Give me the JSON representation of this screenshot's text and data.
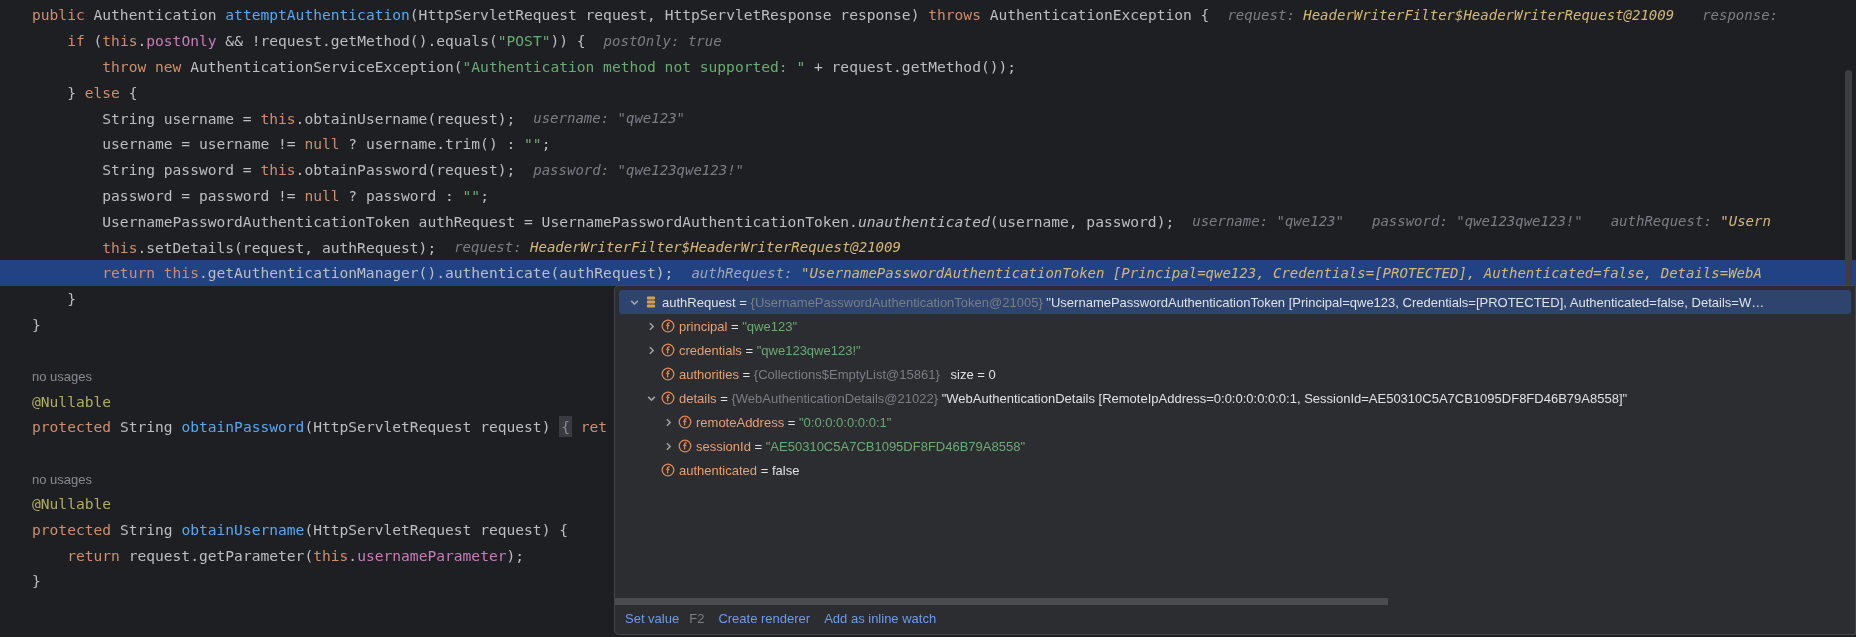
{
  "editor": {
    "lines": [
      {
        "tokens": [
          {
            "kind": "kw",
            "text": "public "
          },
          {
            "kind": "plain",
            "text": "Authentication "
          },
          {
            "kind": "fn",
            "text": "attemptAuthentication"
          },
          {
            "kind": "plain",
            "text": "(HttpServletRequest request, HttpServletResponse response) "
          },
          {
            "kind": "kw",
            "text": "throws "
          },
          {
            "kind": "plain",
            "text": "AuthenticationException {"
          }
        ],
        "hints": [
          {
            "label": "request:",
            "value": "HeaderWriterFilter$HeaderWriterRequest@21009",
            "kind": "object"
          },
          {
            "label": "response:"
          }
        ],
        "highlighted": false
      },
      {
        "tokens": [
          {
            "kind": "kw",
            "text": "    if "
          },
          {
            "kind": "plain",
            "text": "("
          },
          {
            "kind": "kw",
            "text": "this"
          },
          {
            "kind": "plain",
            "text": "."
          },
          {
            "kind": "field",
            "text": "postOnly"
          },
          {
            "kind": "plain",
            "text": " && !request.getMethod().equals("
          },
          {
            "kind": "str",
            "text": "\"POST\""
          },
          {
            "kind": "plain",
            "text": ")) {"
          }
        ],
        "hints": [
          {
            "label": "postOnly:",
            "value": "true",
            "kind": "plain"
          }
        ],
        "highlighted": false
      },
      {
        "tokens": [
          {
            "kind": "kw",
            "text": "        throw new "
          },
          {
            "kind": "plain",
            "text": "AuthenticationServiceException("
          },
          {
            "kind": "str",
            "text": "\"Authentication method not supported: \""
          },
          {
            "kind": "plain",
            "text": " + request.getMethod());"
          }
        ],
        "highlighted": false
      },
      {
        "tokens": [
          {
            "kind": "plain",
            "text": "    } "
          },
          {
            "kind": "kw",
            "text": "else"
          },
          {
            "kind": "plain",
            "text": " {"
          }
        ],
        "highlighted": false
      },
      {
        "tokens": [
          {
            "kind": "plain",
            "text": "        String username = "
          },
          {
            "kind": "kw",
            "text": "this"
          },
          {
            "kind": "plain",
            "text": ".obtainUsername(request);"
          }
        ],
        "hints": [
          {
            "label": "username:",
            "value": "\"qwe123\"",
            "kind": "plain"
          }
        ],
        "highlighted": false
      },
      {
        "tokens": [
          {
            "kind": "plain",
            "text": "        username = username != "
          },
          {
            "kind": "kw",
            "text": "null"
          },
          {
            "kind": "plain",
            "text": " ? username.trim() : "
          },
          {
            "kind": "str",
            "text": "\"\""
          },
          {
            "kind": "plain",
            "text": ";"
          }
        ],
        "highlighted": false
      },
      {
        "tokens": [
          {
            "kind": "plain",
            "text": "        String password = "
          },
          {
            "kind": "kw",
            "text": "this"
          },
          {
            "kind": "plain",
            "text": ".obtainPassword(request);"
          }
        ],
        "hints": [
          {
            "label": "password:",
            "value": "\"qwe123qwe123!\"",
            "kind": "plain"
          }
        ],
        "highlighted": false
      },
      {
        "tokens": [
          {
            "kind": "plain",
            "text": "        password = password != "
          },
          {
            "kind": "kw",
            "text": "null"
          },
          {
            "kind": "plain",
            "text": " ? password : "
          },
          {
            "kind": "str",
            "text": "\"\""
          },
          {
            "kind": "plain",
            "text": ";"
          }
        ],
        "highlighted": false
      },
      {
        "tokens": [
          {
            "kind": "plain",
            "text": "        UsernamePasswordAuthenticationToken authRequest = UsernamePasswordAuthenticationToken."
          },
          {
            "kind": "italic",
            "text": "unauthenticated"
          },
          {
            "kind": "plain",
            "text": "(username, password);"
          }
        ],
        "hints": [
          {
            "label": "username:",
            "value": "\"qwe123\"",
            "kind": "plain"
          },
          {
            "label": "password:",
            "value": "\"qwe123qwe123!\"",
            "kind": "plain"
          },
          {
            "label": "authRequest:",
            "value": "\"Usern",
            "kind": "object"
          }
        ],
        "highlighted": false
      },
      {
        "tokens": [
          {
            "kind": "kw",
            "text": "        this"
          },
          {
            "kind": "plain",
            "text": ".setDetails(request, authRequest);"
          }
        ],
        "hints": [
          {
            "label": "request:",
            "value": "HeaderWriterFilter$HeaderWriterRequest@21009",
            "kind": "object"
          }
        ],
        "highlighted": false
      },
      {
        "tokens": [
          {
            "kind": "kw",
            "text": "        return this"
          },
          {
            "kind": "plain",
            "text": ".getAuthenticationManager().authenticate(authRequest);"
          }
        ],
        "hints": [
          {
            "label": "authRequest:",
            "value": "\"UsernamePasswordAuthenticationToken [Principal=qwe123, Credentials=[PROTECTED], Authenticated=false, Details=WebA",
            "kind": "object"
          }
        ],
        "highlighted": true
      },
      {
        "tokens": [
          {
            "kind": "plain",
            "text": "    }"
          }
        ],
        "highlighted": false
      },
      {
        "tokens": [
          {
            "kind": "plain",
            "text": "}"
          }
        ],
        "highlighted": false
      },
      {
        "highlighted": false
      },
      {
        "tokens": [
          {
            "kind": "usage",
            "text": "no usages"
          }
        ],
        "highlighted": false
      },
      {
        "tokens": [
          {
            "kind": "ann",
            "text": "@Nullable"
          }
        ],
        "highlighted": false
      },
      {
        "tokens": [
          {
            "kind": "kw",
            "text": "protected "
          },
          {
            "kind": "plain",
            "text": "String "
          },
          {
            "kind": "fn",
            "text": "obtainPassword"
          },
          {
            "kind": "plain",
            "text": "(HttpServletRequest request) "
          },
          {
            "kind": "fold",
            "text": "{"
          },
          {
            "kind": "kw",
            "text": " ret"
          }
        ],
        "highlighted": false
      },
      {
        "highlighted": false
      },
      {
        "tokens": [
          {
            "kind": "usage",
            "text": "no usages"
          }
        ],
        "highlighted": false
      },
      {
        "tokens": [
          {
            "kind": "ann",
            "text": "@Nullable"
          }
        ],
        "highlighted": false
      },
      {
        "tokens": [
          {
            "kind": "kw",
            "text": "protected "
          },
          {
            "kind": "plain",
            "text": "String "
          },
          {
            "kind": "fn",
            "text": "obtainUsername"
          },
          {
            "kind": "plain",
            "text": "(HttpServletRequest request) {"
          }
        ],
        "highlighted": false
      },
      {
        "tokens": [
          {
            "kind": "kw",
            "text": "    return "
          },
          {
            "kind": "plain",
            "text": "request.getParameter("
          },
          {
            "kind": "kw",
            "text": "this"
          },
          {
            "kind": "plain",
            "text": "."
          },
          {
            "kind": "field",
            "text": "usernameParameter"
          },
          {
            "kind": "plain",
            "text": ");"
          }
        ],
        "highlighted": false
      },
      {
        "tokens": [
          {
            "kind": "plain",
            "text": "}"
          }
        ],
        "highlighted": false
      }
    ]
  },
  "debug_popup": {
    "tree": [
      {
        "kind": "watch",
        "name": "authRequest",
        "separator": "=",
        "ref": "{UsernamePasswordAuthenticationToken@21005}",
        "value": {
          "kind": "plain",
          "text": "\"UsernamePasswordAuthenticationToken [Principal=qwe123, Credentials=[PROTECTED], Authenticated=false, Details=W…"
        },
        "selected": true,
        "expanded": true,
        "children": [
          {
            "kind": "field",
            "name": "principal",
            "separator": "=",
            "value": {
              "kind": "string",
              "text": "\"qwe123\""
            },
            "selected": false,
            "expanded": false
          },
          {
            "kind": "field",
            "name": "credentials",
            "separator": "=",
            "value": {
              "kind": "string",
              "text": "\"qwe123qwe123!\""
            },
            "selected": false,
            "expanded": false
          },
          {
            "kind": "field",
            "name": "authorities",
            "separator": "=",
            "ref": "{Collections$EmptyList@15861}",
            "extra": "size = 0",
            "selected": false
          },
          {
            "kind": "field",
            "name": "details",
            "separator": "=",
            "ref": "{WebAuthenticationDetails@21022}",
            "value": {
              "kind": "plain",
              "text": "\"WebAuthenticationDetails [RemoteIpAddress=0:0:0:0:0:0:0:1, SessionId=AE50310C5A7CB1095DF8FD46B79A8558]\""
            },
            "selected": false,
            "expanded": true,
            "children": [
              {
                "kind": "field",
                "name": "remoteAddress",
                "separator": "=",
                "value": {
                  "kind": "string",
                  "text": "\"0:0:0:0:0:0:0:1\""
                },
                "selected": false,
                "expanded": false
              },
              {
                "kind": "field",
                "name": "sessionId",
                "separator": "=",
                "value": {
                  "kind": "string",
                  "text": "\"AE50310C5A7CB1095DF8FD46B79A8558\""
                },
                "selected": false,
                "expanded": false
              }
            ]
          },
          {
            "kind": "field",
            "name": "authenticated",
            "separator": "=",
            "value": {
              "kind": "plain",
              "text": "false"
            },
            "selected": false
          }
        ]
      }
    ],
    "actions": [
      {
        "label": "Set value",
        "shortcut": "F2"
      },
      {
        "label": "Create renderer"
      },
      {
        "label": "Add as inline watch"
      }
    ]
  }
}
